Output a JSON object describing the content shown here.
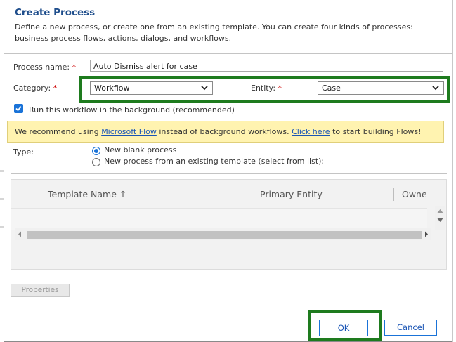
{
  "dialog": {
    "title": "Create Process",
    "description": "Define a new process, or create one from an existing template. You can create four kinds of processes: business process flows, actions, dialogs, and workflows."
  },
  "form": {
    "process_name_label": "Process name:",
    "process_name_value": "Auto Dismiss alert for case",
    "category_label": "Category:",
    "category_value": "Workflow",
    "entity_label": "Entity:",
    "entity_value": "Case",
    "required_marker": "*",
    "background_checkbox_label": "Run this workflow in the background (recommended)",
    "background_checked": true
  },
  "banner": {
    "text_1": "We recommend using ",
    "link_1": "Microsoft Flow",
    "text_2": " instead of background workflows. ",
    "link_2": "Click here",
    "text_3": " to start building Flows!"
  },
  "type": {
    "label": "Type:",
    "options": [
      "New blank process",
      "New process from an existing template (select from list):"
    ],
    "selected_index": 0
  },
  "grid": {
    "columns": [
      "Template Name ↑",
      "Primary Entity",
      "Owne"
    ]
  },
  "buttons": {
    "properties": "Properties",
    "ok": "OK",
    "cancel": "Cancel"
  },
  "colors": {
    "title": "#1f4e8c",
    "accent": "#1a73d8",
    "highlight": "#1e7b1e",
    "banner_bg": "#fff3b0",
    "required": "#cc0000"
  },
  "icons": [
    "chevron-down-icon",
    "checkmark-icon",
    "sort-ascending-icon",
    "scroll-up-icon",
    "scroll-down-icon",
    "scroll-left-icon",
    "scroll-right-icon"
  ]
}
